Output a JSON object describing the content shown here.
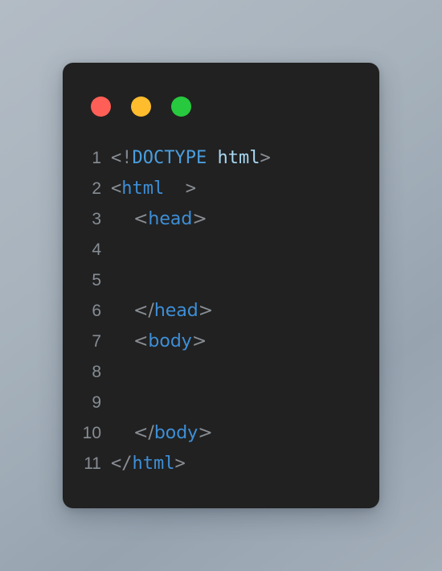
{
  "window": {
    "controls": [
      {
        "name": "close",
        "color": "#ff5f56"
      },
      {
        "name": "minimize",
        "color": "#ffbd2e"
      },
      {
        "name": "maximize",
        "color": "#27c93f"
      }
    ]
  },
  "theme": {
    "page_background_from": "#b3bcc5",
    "page_background_to": "#97a4b0",
    "card_background": "#212121",
    "gutter_color": "#868d94",
    "punctuation_color": "#8a8f95",
    "tag_color": "#3d8fd8",
    "doctype_color": "#4a9ede",
    "doctype_value_color": "#a9d8f2"
  },
  "editor": {
    "language": "html",
    "line_count": 11,
    "lines": [
      {
        "number": "1",
        "font": "mono",
        "indent": "",
        "tokens": [
          {
            "text": "<",
            "type": "punct"
          },
          {
            "text": "!",
            "type": "bang"
          },
          {
            "text": "DOCTYPE",
            "type": "doctype"
          },
          {
            "text": " ",
            "type": "space"
          },
          {
            "text": "html",
            "type": "tag-lite"
          },
          {
            "text": ">",
            "type": "punct"
          }
        ]
      },
      {
        "number": "2",
        "font": "mono",
        "indent": "",
        "tokens": [
          {
            "text": "<",
            "type": "punct"
          },
          {
            "text": "html",
            "type": "tag"
          },
          {
            "text": "  ",
            "type": "space"
          },
          {
            "text": ">",
            "type": "punct"
          }
        ]
      },
      {
        "number": "3",
        "font": "sans",
        "indent": "    ",
        "tokens": [
          {
            "text": "<",
            "type": "punct"
          },
          {
            "text": "head",
            "type": "tag"
          },
          {
            "text": ">",
            "type": "punct"
          }
        ]
      },
      {
        "number": "4",
        "font": "sans",
        "indent": "",
        "tokens": []
      },
      {
        "number": "5",
        "font": "sans",
        "indent": "",
        "tokens": []
      },
      {
        "number": "6",
        "font": "sans",
        "indent": "    ",
        "tokens": [
          {
            "text": "<",
            "type": "punct"
          },
          {
            "text": "/",
            "type": "punct"
          },
          {
            "text": "head",
            "type": "tag"
          },
          {
            "text": ">",
            "type": "punct"
          }
        ]
      },
      {
        "number": "7",
        "font": "sans",
        "indent": "    ",
        "tokens": [
          {
            "text": "<",
            "type": "punct"
          },
          {
            "text": "body",
            "type": "tag"
          },
          {
            "text": ">",
            "type": "punct"
          }
        ]
      },
      {
        "number": "8",
        "font": "sans",
        "indent": "",
        "tokens": []
      },
      {
        "number": "9",
        "font": "sans",
        "indent": "",
        "tokens": []
      },
      {
        "number": "10",
        "font": "sans",
        "indent": "    ",
        "tokens": [
          {
            "text": "<",
            "type": "punct"
          },
          {
            "text": "/",
            "type": "punct"
          },
          {
            "text": "body",
            "type": "tag"
          },
          {
            "text": ">",
            "type": "punct"
          }
        ]
      },
      {
        "number": "11",
        "font": "mono",
        "indent": "",
        "tokens": [
          {
            "text": "<",
            "type": "punct"
          },
          {
            "text": "/",
            "type": "punct"
          },
          {
            "text": "html",
            "type": "tag"
          },
          {
            "text": ">",
            "type": "punct"
          }
        ]
      }
    ]
  }
}
